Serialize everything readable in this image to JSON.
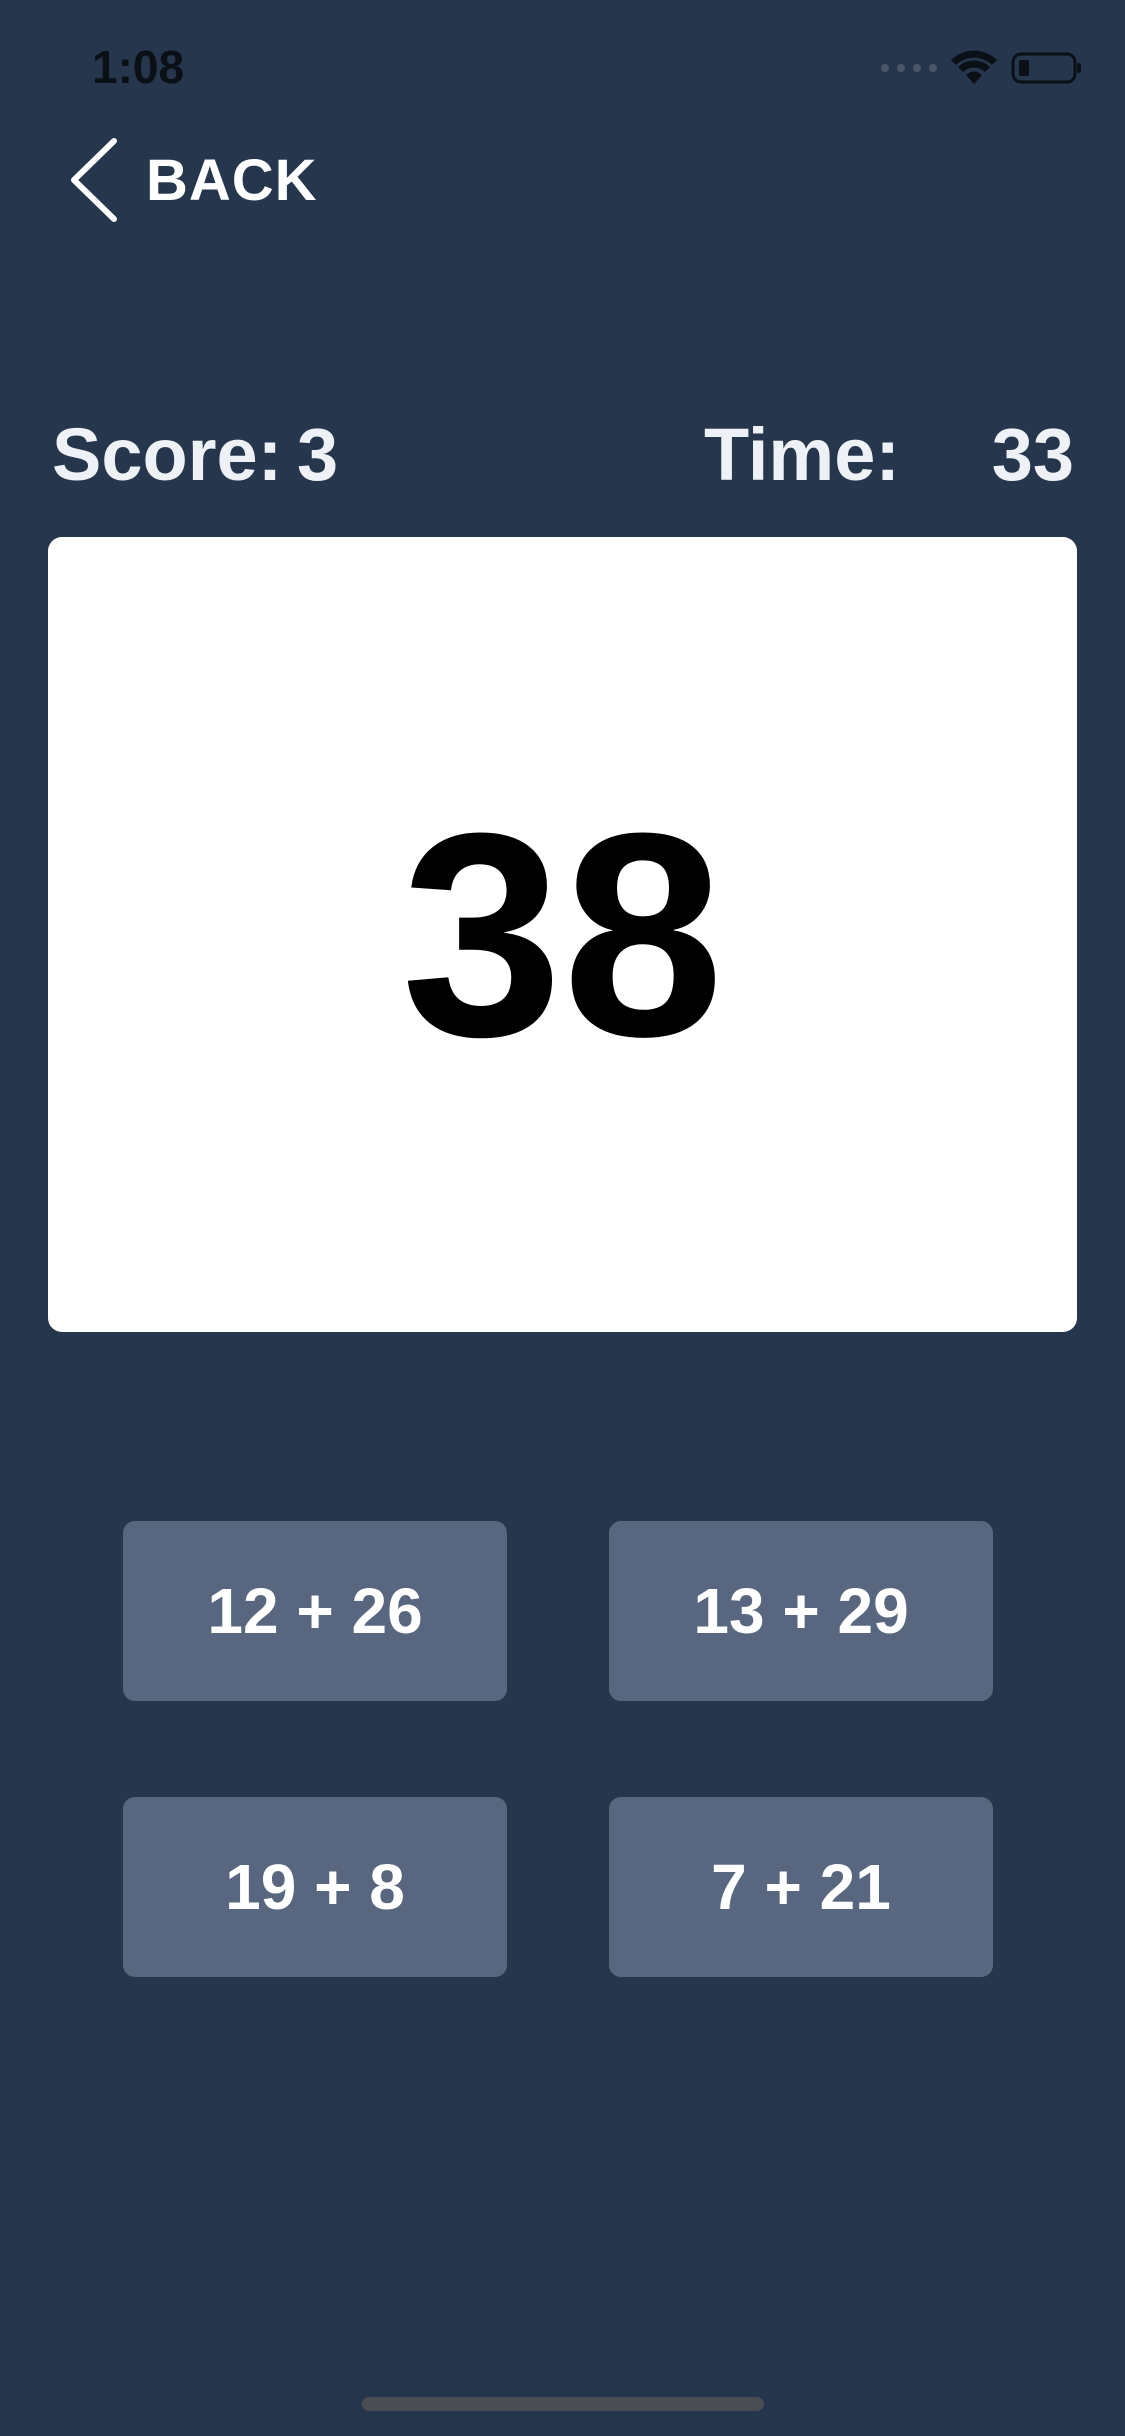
{
  "status_bar": {
    "time": "1:08",
    "icons": [
      "cellular-signal-icon",
      "wifi-icon",
      "battery-icon"
    ]
  },
  "nav": {
    "back_label": "BACK",
    "back_icon": "chevron-left-icon"
  },
  "game": {
    "score_label": "Score:",
    "score_value": "3",
    "time_label": "Time:",
    "time_value": "33",
    "target": "38"
  },
  "answers": [
    {
      "label": "12 + 26"
    },
    {
      "label": "13 + 29"
    },
    {
      "label": "19 + 8"
    },
    {
      "label": "7 + 21"
    }
  ],
  "colors": {
    "background": "#26364d",
    "card": "#ffffff",
    "answer_button": "#58677f",
    "text": "#ffffff"
  }
}
